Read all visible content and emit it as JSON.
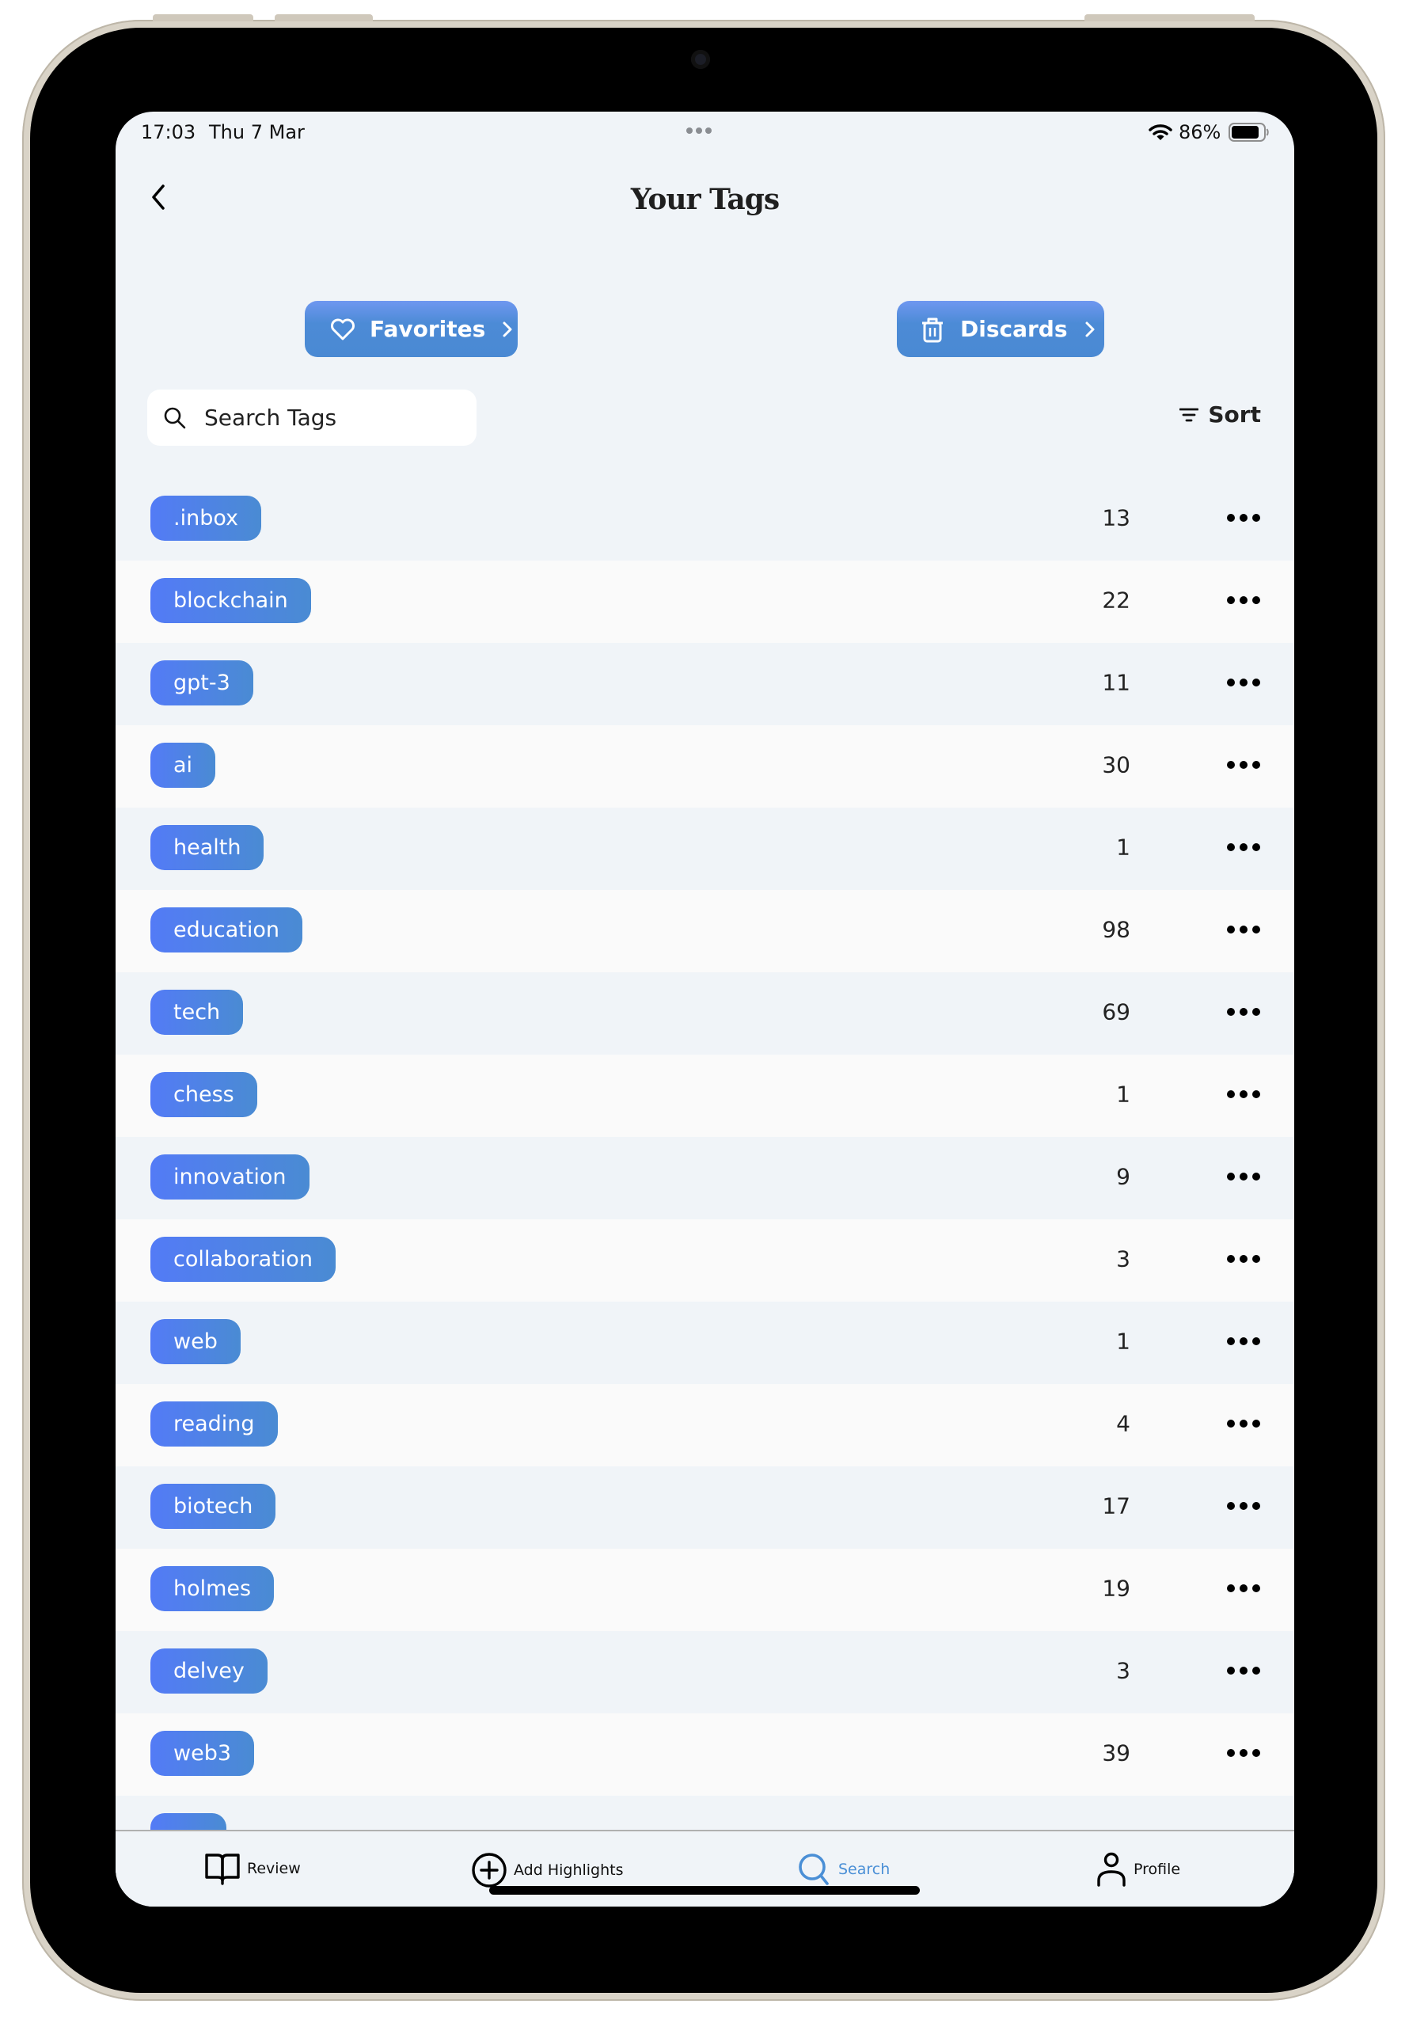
{
  "status_bar": {
    "time": "17:03",
    "date": "Thu 7 Mar",
    "battery_percent": "86%",
    "battery_level": 0.86,
    "wifi_icon": "wifi-icon",
    "battery_icon": "battery-icon"
  },
  "header": {
    "title": "Your Tags",
    "back_icon": "chevron-left-icon"
  },
  "actions": {
    "favorites_label": "Favorites",
    "favorites_icon": "heart-icon",
    "discards_label": "Discards",
    "discards_icon": "trash-icon"
  },
  "search": {
    "placeholder": "Search Tags",
    "value": ""
  },
  "sort": {
    "label": "Sort",
    "icon": "filter-icon"
  },
  "colors": {
    "accent": "#4a8bd6",
    "chip_gradient_start": "#537bf6",
    "chip_gradient_end": "#4a8bd3",
    "active_tab": "#4a8fd6"
  },
  "tags": [
    {
      "name": ".inbox",
      "count": "13"
    },
    {
      "name": "blockchain",
      "count": "22"
    },
    {
      "name": "gpt-3",
      "count": "11"
    },
    {
      "name": "ai",
      "count": "30"
    },
    {
      "name": "health",
      "count": "1"
    },
    {
      "name": "education",
      "count": "98"
    },
    {
      "name": "tech",
      "count": "69"
    },
    {
      "name": "chess",
      "count": "1"
    },
    {
      "name": "innovation",
      "count": "9"
    },
    {
      "name": "collaboration",
      "count": "3"
    },
    {
      "name": "web",
      "count": "1"
    },
    {
      "name": "reading",
      "count": "4"
    },
    {
      "name": "biotech",
      "count": "17"
    },
    {
      "name": "holmes",
      "count": "19"
    },
    {
      "name": "delvey",
      "count": "3"
    },
    {
      "name": "web3",
      "count": "39"
    },
    {
      "name": "",
      "count": ""
    }
  ],
  "tab_bar": {
    "items": [
      {
        "label": "Review",
        "icon": "book-icon",
        "active": false
      },
      {
        "label": "Add Highlights",
        "icon": "plus-circle-icon",
        "active": false
      },
      {
        "label": "Search",
        "icon": "search-icon",
        "active": true
      },
      {
        "label": "Profile",
        "icon": "person-icon",
        "active": false
      }
    ]
  }
}
